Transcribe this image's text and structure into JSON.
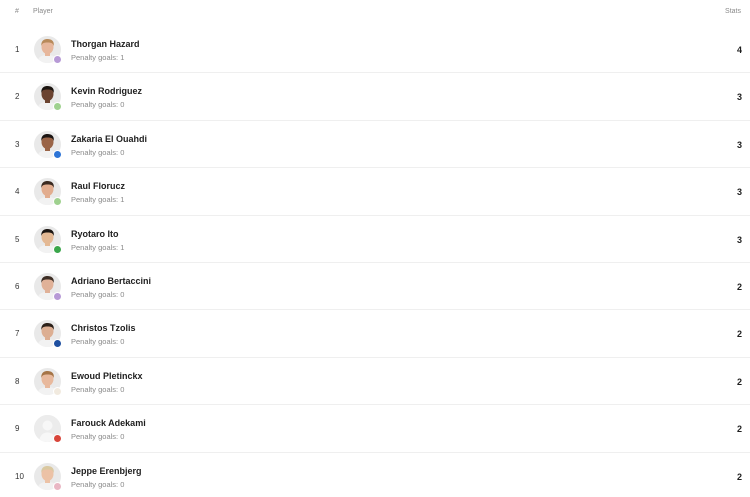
{
  "header": {
    "rank": "#",
    "player": "Player",
    "stats": "Stats"
  },
  "rows": [
    {
      "rank": "1",
      "name": "Thorgan Hazard",
      "sub": "Penalty goals: 1",
      "stat": "4",
      "skin": "#e7b79c",
      "hair": "#b88a5a",
      "club": "#b79ad6"
    },
    {
      "rank": "2",
      "name": "Kevin Rodriguez",
      "sub": "Penalty goals: 0",
      "stat": "3",
      "skin": "#6b4330",
      "hair": "#1b1410",
      "club": "#9fd18f"
    },
    {
      "rank": "3",
      "name": "Zakaria El Ouahdi",
      "sub": "Penalty goals: 0",
      "stat": "3",
      "skin": "#9a6447",
      "hair": "#1a1412",
      "club": "#2d74d6"
    },
    {
      "rank": "4",
      "name": "Raul Florucz",
      "sub": "Penalty goals: 1",
      "stat": "3",
      "skin": "#e2ad8f",
      "hair": "#3b2a20",
      "club": "#9fd18f"
    },
    {
      "rank": "5",
      "name": "Ryotaro Ito",
      "sub": "Penalty goals: 1",
      "stat": "3",
      "skin": "#e4b994",
      "hair": "#1c1612",
      "club": "#3aa64b"
    },
    {
      "rank": "6",
      "name": "Adriano Bertaccini",
      "sub": "Penalty goals: 0",
      "stat": "2",
      "skin": "#e0b198",
      "hair": "#3d2e25",
      "club": "#b79ad6"
    },
    {
      "rank": "7",
      "name": "Christos Tzolis",
      "sub": "Penalty goals: 0",
      "stat": "2",
      "skin": "#dcae92",
      "hair": "#2b2019",
      "club": "#1e4fa0"
    },
    {
      "rank": "8",
      "name": "Ewoud Pletinckx",
      "sub": "Penalty goals: 0",
      "stat": "2",
      "skin": "#e8b99d",
      "hair": "#a57446",
      "club": "#f1eadf"
    },
    {
      "rank": "9",
      "name": "Farouck Adekami",
      "sub": "Penalty goals: 0",
      "stat": "2",
      "skin": "",
      "hair": "",
      "club": "#d8453a"
    },
    {
      "rank": "10",
      "name": "Jeppe Erenbjerg",
      "sub": "Penalty goals: 0",
      "stat": "2",
      "skin": "#ecc2a6",
      "hair": "#d9c8a0",
      "club": "#e9b7c4"
    }
  ]
}
